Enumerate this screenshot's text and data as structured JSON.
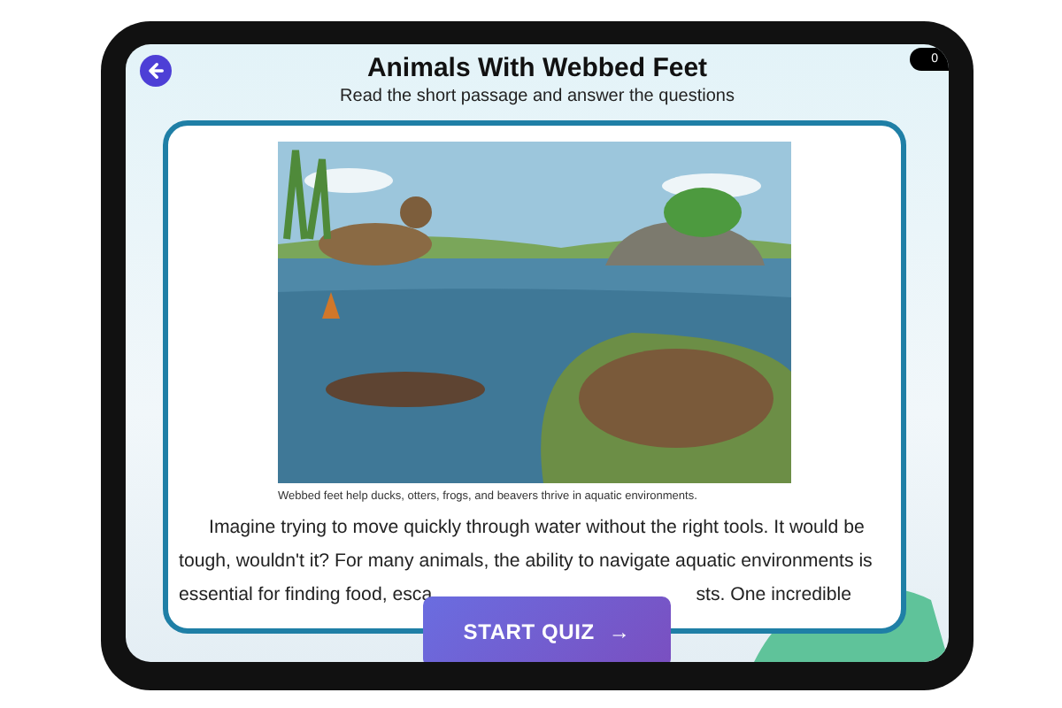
{
  "header": {
    "title": "Animals With Webbed Feet",
    "subtitle": "Read the short passage and answer the questions",
    "counter": "0"
  },
  "figure": {
    "kind": "picture",
    "caption": "Webbed feet help ducks, otters, frogs, and beavers thrive in aquatic environments."
  },
  "passage": {
    "lines": [
      "Imagine trying to move quickly through water without the right tools. It would be",
      "tough, wouldn't it? For many animals, the ability to navigate aquatic environments is"
    ],
    "partial_line": [
      "essential for finding food, esca",
      "sts. One incredible"
    ]
  },
  "start_button": {
    "label": "START QUIZ",
    "arrow": "→"
  }
}
